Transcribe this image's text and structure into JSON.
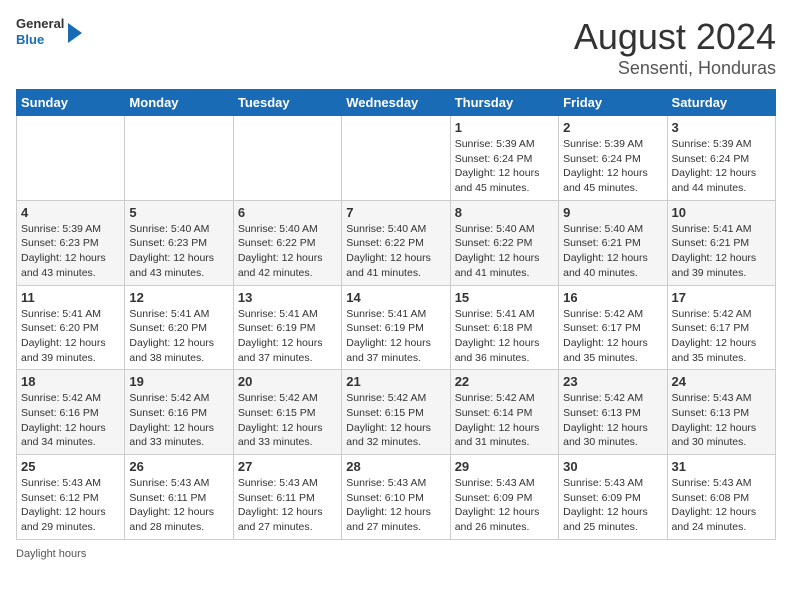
{
  "header": {
    "logo": {
      "general": "General",
      "blue": "Blue"
    },
    "title": "August 2024",
    "subtitle": "Sensenti, Honduras"
  },
  "calendar": {
    "days_of_week": [
      "Sunday",
      "Monday",
      "Tuesday",
      "Wednesday",
      "Thursday",
      "Friday",
      "Saturday"
    ],
    "weeks": [
      [
        {
          "day": "",
          "info": ""
        },
        {
          "day": "",
          "info": ""
        },
        {
          "day": "",
          "info": ""
        },
        {
          "day": "",
          "info": ""
        },
        {
          "day": "1",
          "info": "Sunrise: 5:39 AM\nSunset: 6:24 PM\nDaylight: 12 hours and 45 minutes."
        },
        {
          "day": "2",
          "info": "Sunrise: 5:39 AM\nSunset: 6:24 PM\nDaylight: 12 hours and 45 minutes."
        },
        {
          "day": "3",
          "info": "Sunrise: 5:39 AM\nSunset: 6:24 PM\nDaylight: 12 hours and 44 minutes."
        }
      ],
      [
        {
          "day": "4",
          "info": "Sunrise: 5:39 AM\nSunset: 6:23 PM\nDaylight: 12 hours and 43 minutes."
        },
        {
          "day": "5",
          "info": "Sunrise: 5:40 AM\nSunset: 6:23 PM\nDaylight: 12 hours and 43 minutes."
        },
        {
          "day": "6",
          "info": "Sunrise: 5:40 AM\nSunset: 6:22 PM\nDaylight: 12 hours and 42 minutes."
        },
        {
          "day": "7",
          "info": "Sunrise: 5:40 AM\nSunset: 6:22 PM\nDaylight: 12 hours and 41 minutes."
        },
        {
          "day": "8",
          "info": "Sunrise: 5:40 AM\nSunset: 6:22 PM\nDaylight: 12 hours and 41 minutes."
        },
        {
          "day": "9",
          "info": "Sunrise: 5:40 AM\nSunset: 6:21 PM\nDaylight: 12 hours and 40 minutes."
        },
        {
          "day": "10",
          "info": "Sunrise: 5:41 AM\nSunset: 6:21 PM\nDaylight: 12 hours and 39 minutes."
        }
      ],
      [
        {
          "day": "11",
          "info": "Sunrise: 5:41 AM\nSunset: 6:20 PM\nDaylight: 12 hours and 39 minutes."
        },
        {
          "day": "12",
          "info": "Sunrise: 5:41 AM\nSunset: 6:20 PM\nDaylight: 12 hours and 38 minutes."
        },
        {
          "day": "13",
          "info": "Sunrise: 5:41 AM\nSunset: 6:19 PM\nDaylight: 12 hours and 37 minutes."
        },
        {
          "day": "14",
          "info": "Sunrise: 5:41 AM\nSunset: 6:19 PM\nDaylight: 12 hours and 37 minutes."
        },
        {
          "day": "15",
          "info": "Sunrise: 5:41 AM\nSunset: 6:18 PM\nDaylight: 12 hours and 36 minutes."
        },
        {
          "day": "16",
          "info": "Sunrise: 5:42 AM\nSunset: 6:17 PM\nDaylight: 12 hours and 35 minutes."
        },
        {
          "day": "17",
          "info": "Sunrise: 5:42 AM\nSunset: 6:17 PM\nDaylight: 12 hours and 35 minutes."
        }
      ],
      [
        {
          "day": "18",
          "info": "Sunrise: 5:42 AM\nSunset: 6:16 PM\nDaylight: 12 hours and 34 minutes."
        },
        {
          "day": "19",
          "info": "Sunrise: 5:42 AM\nSunset: 6:16 PM\nDaylight: 12 hours and 33 minutes."
        },
        {
          "day": "20",
          "info": "Sunrise: 5:42 AM\nSunset: 6:15 PM\nDaylight: 12 hours and 33 minutes."
        },
        {
          "day": "21",
          "info": "Sunrise: 5:42 AM\nSunset: 6:15 PM\nDaylight: 12 hours and 32 minutes."
        },
        {
          "day": "22",
          "info": "Sunrise: 5:42 AM\nSunset: 6:14 PM\nDaylight: 12 hours and 31 minutes."
        },
        {
          "day": "23",
          "info": "Sunrise: 5:42 AM\nSunset: 6:13 PM\nDaylight: 12 hours and 30 minutes."
        },
        {
          "day": "24",
          "info": "Sunrise: 5:43 AM\nSunset: 6:13 PM\nDaylight: 12 hours and 30 minutes."
        }
      ],
      [
        {
          "day": "25",
          "info": "Sunrise: 5:43 AM\nSunset: 6:12 PM\nDaylight: 12 hours and 29 minutes."
        },
        {
          "day": "26",
          "info": "Sunrise: 5:43 AM\nSunset: 6:11 PM\nDaylight: 12 hours and 28 minutes."
        },
        {
          "day": "27",
          "info": "Sunrise: 5:43 AM\nSunset: 6:11 PM\nDaylight: 12 hours and 27 minutes."
        },
        {
          "day": "28",
          "info": "Sunrise: 5:43 AM\nSunset: 6:10 PM\nDaylight: 12 hours and 27 minutes."
        },
        {
          "day": "29",
          "info": "Sunrise: 5:43 AM\nSunset: 6:09 PM\nDaylight: 12 hours and 26 minutes."
        },
        {
          "day": "30",
          "info": "Sunrise: 5:43 AM\nSunset: 6:09 PM\nDaylight: 12 hours and 25 minutes."
        },
        {
          "day": "31",
          "info": "Sunrise: 5:43 AM\nSunset: 6:08 PM\nDaylight: 12 hours and 24 minutes."
        }
      ]
    ]
  },
  "footer": {
    "daylight_hours_label": "Daylight hours"
  }
}
